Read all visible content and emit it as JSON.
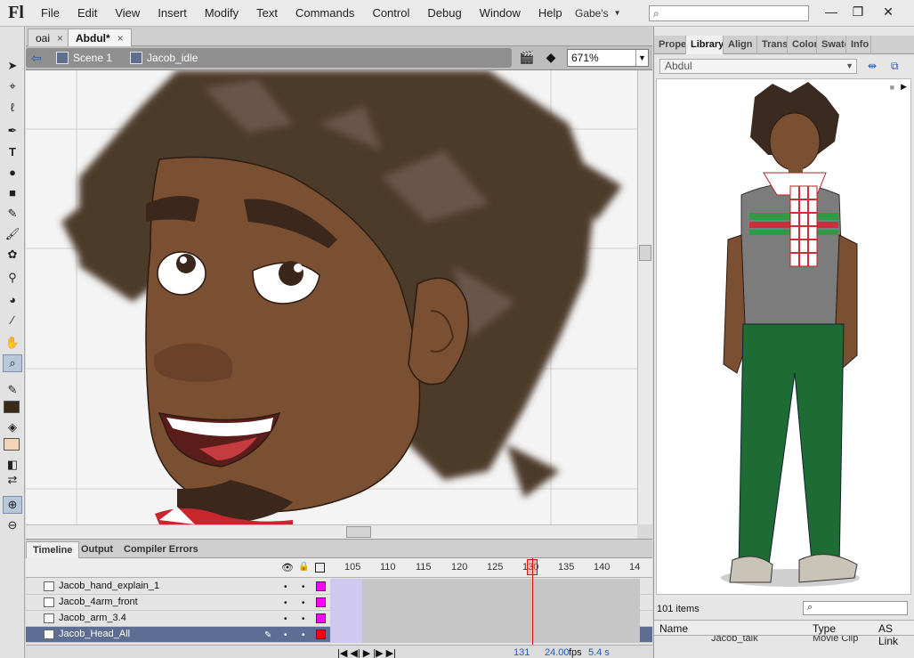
{
  "app": {
    "logo": "Fl",
    "menu": [
      "File",
      "Edit",
      "View",
      "Insert",
      "Modify",
      "Text",
      "Commands",
      "Control",
      "Debug",
      "Window",
      "Help"
    ],
    "workspace": "Gabe's",
    "window_controls": [
      "—",
      "❐",
      "✕"
    ]
  },
  "doc_tabs": [
    {
      "label": "oai",
      "close": "×"
    },
    {
      "label": "Abdul*",
      "close": "×"
    }
  ],
  "editbar": {
    "back": "⇦",
    "scene": "Scene 1",
    "symbol": "Jacob_idle",
    "zoom": "671%"
  },
  "timeline": {
    "tabs": [
      "Timeline",
      "Output",
      "Compiler Errors"
    ],
    "frame_numbers": [
      "105",
      "110",
      "115",
      "120",
      "125",
      "130",
      "135",
      "140",
      "14"
    ],
    "current_frame": 131,
    "layers": [
      {
        "name": "Jacob_hand_explain_1",
        "color": "#ff00ff",
        "selected": false
      },
      {
        "name": "Jacob_4arm_front",
        "color": "#ff00ff",
        "selected": false
      },
      {
        "name": "Jacob_arm_3.4",
        "color": "#ff00ff",
        "selected": false
      },
      {
        "name": "Jacob_Head_All",
        "color": "#ff0000",
        "selected": true
      }
    ],
    "status": {
      "frame": "131",
      "fps": "24.00",
      "fps_unit": "fps",
      "time": "5.4 s"
    }
  },
  "library": {
    "tabs": [
      "Prope",
      "Library",
      "Align",
      "Trans",
      "Color",
      "Swatc",
      "Info"
    ],
    "active_tab": "Library",
    "document": "Abdul",
    "items_count": "101 items",
    "columns": [
      "Name",
      "Type",
      "AS Link"
    ],
    "visible_row": {
      "name": "Jacob_talk",
      "type": "Movie Clip"
    }
  },
  "colors": {
    "stroke": "#3a2a1a",
    "fill": "#f3d5b5",
    "accent": "#5e6d93"
  }
}
